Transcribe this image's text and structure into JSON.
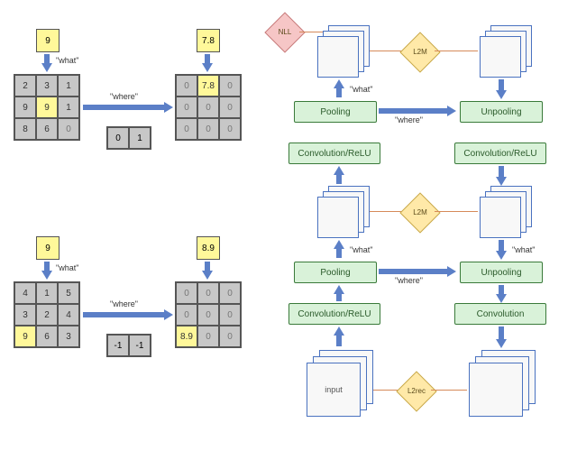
{
  "left_panel": {
    "example1": {
      "pooled_value": "9",
      "output_value": "7.8",
      "what_label": "\"what\"",
      "where_label": "\"where\"",
      "where_offset": [
        "0",
        "1"
      ],
      "input_grid": [
        [
          "2",
          "3",
          "1"
        ],
        [
          "9",
          "9",
          "1"
        ],
        [
          "8",
          "6",
          "0"
        ]
      ],
      "input_highlight": [
        1,
        1
      ],
      "output_grid": [
        [
          "0",
          "7.8",
          "0"
        ],
        [
          "0",
          "0",
          "0"
        ],
        [
          "0",
          "0",
          "0"
        ]
      ],
      "output_highlight": [
        0,
        1
      ]
    },
    "example2": {
      "pooled_value": "9",
      "output_value": "8.9",
      "what_label": "\"what\"",
      "where_label": "\"where\"",
      "where_offset": [
        "-1",
        "-1"
      ],
      "input_grid": [
        [
          "4",
          "1",
          "5"
        ],
        [
          "3",
          "2",
          "4"
        ],
        [
          "9",
          "6",
          "3"
        ]
      ],
      "input_highlight": [
        2,
        0
      ],
      "output_grid": [
        [
          "0",
          "0",
          "0"
        ],
        [
          "0",
          "0",
          "0"
        ],
        [
          "8.9",
          "0",
          "0"
        ]
      ],
      "output_highlight": [
        2,
        0
      ]
    }
  },
  "right_panel": {
    "blocks": {
      "conv_relu": "Convolution/ReLU",
      "pooling": "Pooling",
      "unpooling": "Unpooling",
      "convolution": "Convolution",
      "input": "input"
    },
    "labels": {
      "what": "\"what\"",
      "where": "\"where\""
    },
    "losses": {
      "nll": "NLL",
      "l2m": "L2M",
      "l2rec": "L2rec"
    }
  }
}
